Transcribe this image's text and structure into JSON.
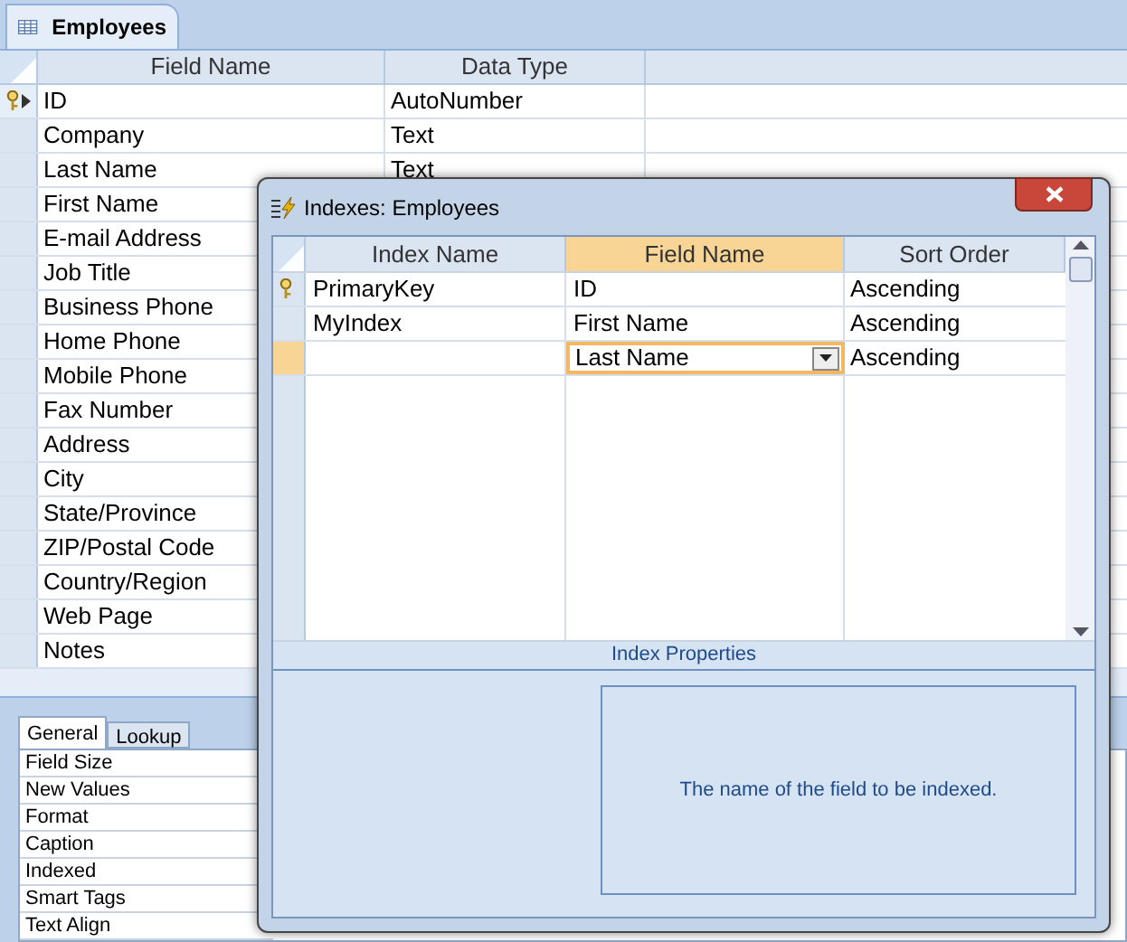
{
  "document_tab": {
    "title": "Employees"
  },
  "table": {
    "columns": [
      "Field Name",
      "Data Type"
    ],
    "rows": [
      {
        "field_name": "ID",
        "data_type": "AutoNumber",
        "primary_key": true,
        "selected": true
      },
      {
        "field_name": "Company",
        "data_type": "Text",
        "primary_key": false,
        "selected": false
      },
      {
        "field_name": "Last Name",
        "data_type": "Text",
        "primary_key": false,
        "selected": false
      },
      {
        "field_name": "First Name",
        "primary_key": false,
        "selected": false
      },
      {
        "field_name": "E-mail Address",
        "primary_key": false,
        "selected": false
      },
      {
        "field_name": "Job Title",
        "primary_key": false,
        "selected": false
      },
      {
        "field_name": "Business Phone",
        "primary_key": false,
        "selected": false
      },
      {
        "field_name": "Home Phone",
        "primary_key": false,
        "selected": false
      },
      {
        "field_name": "Mobile Phone",
        "primary_key": false,
        "selected": false
      },
      {
        "field_name": "Fax Number",
        "primary_key": false,
        "selected": false
      },
      {
        "field_name": "Address",
        "primary_key": false,
        "selected": false
      },
      {
        "field_name": "City",
        "primary_key": false,
        "selected": false
      },
      {
        "field_name": "State/Province",
        "primary_key": false,
        "selected": false
      },
      {
        "field_name": "ZIP/Postal Code",
        "primary_key": false,
        "selected": false
      },
      {
        "field_name": "Country/Region",
        "primary_key": false,
        "selected": false
      },
      {
        "field_name": "Web Page",
        "primary_key": false,
        "selected": false
      },
      {
        "field_name": "Notes",
        "primary_key": false,
        "selected": false
      }
    ]
  },
  "field_properties": {
    "tabs": [
      {
        "label": "General",
        "selected": true
      },
      {
        "label": "Lookup",
        "selected": false
      }
    ],
    "rows": [
      "Field Size",
      "New Values",
      "Format",
      "Caption",
      "Indexed",
      "Smart Tags",
      "Text Align"
    ]
  },
  "dialog": {
    "title": "Indexes: Employees",
    "columns": [
      {
        "label": "Index Name",
        "highlighted": false
      },
      {
        "label": "Field Name",
        "highlighted": true
      },
      {
        "label": "Sort Order",
        "highlighted": false
      }
    ],
    "rows": [
      {
        "index_name": "PrimaryKey",
        "field_name": "ID",
        "sort_order": "Ascending",
        "primary_key": true,
        "selected": false,
        "editing": false
      },
      {
        "index_name": "MyIndex",
        "field_name": "First Name",
        "sort_order": "Ascending",
        "primary_key": false,
        "selected": false,
        "editing": false
      },
      {
        "field_name": "Last Name",
        "sort_order": "Ascending",
        "primary_key": false,
        "selected": true,
        "editing": true
      }
    ],
    "properties_title": "Index Properties",
    "help_text": "The name of the field to be indexed."
  }
}
